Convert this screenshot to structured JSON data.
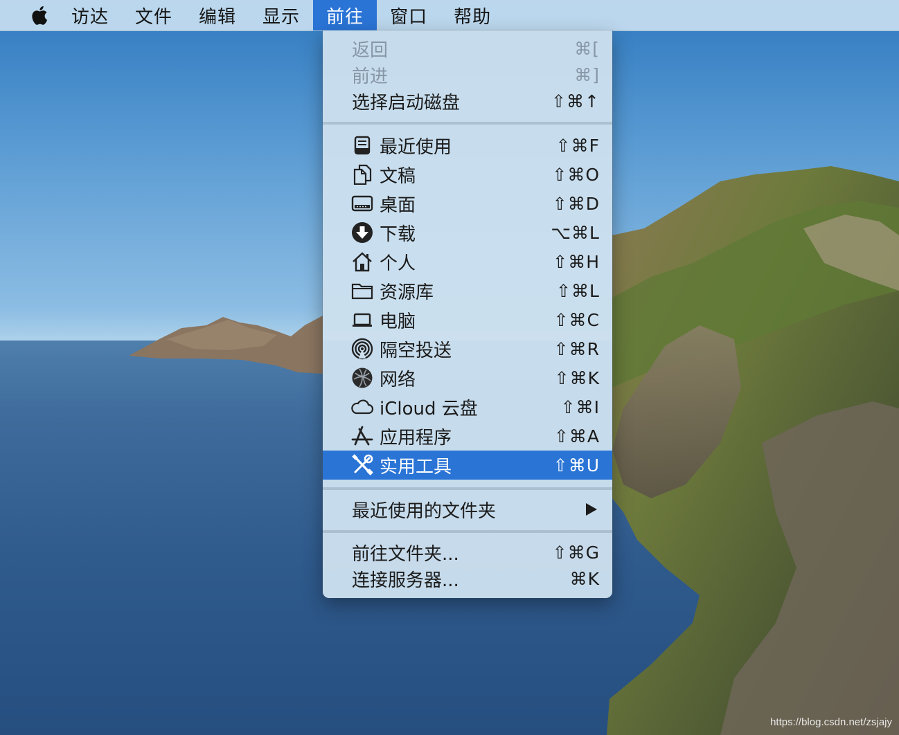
{
  "menubar": {
    "apple_icon": "apple-logo-icon",
    "items": [
      {
        "label": "访达"
      },
      {
        "label": "文件"
      },
      {
        "label": "编辑"
      },
      {
        "label": "显示"
      },
      {
        "label": "前往",
        "active": true
      },
      {
        "label": "窗口"
      },
      {
        "label": "帮助"
      }
    ]
  },
  "go_menu": {
    "nav": [
      {
        "label": "返回",
        "shortcut": "⌘[",
        "enabled": false
      },
      {
        "label": "前进",
        "shortcut": "⌘]",
        "enabled": false
      },
      {
        "label": "选择启动磁盘",
        "shortcut": "⇧⌘↑",
        "enabled": true
      }
    ],
    "places": [
      {
        "label": "最近使用",
        "shortcut": "⇧⌘F",
        "icon": "recents-icon"
      },
      {
        "label": "文稿",
        "shortcut": "⇧⌘O",
        "icon": "documents-icon"
      },
      {
        "label": "桌面",
        "shortcut": "⇧⌘D",
        "icon": "desktop-icon"
      },
      {
        "label": "下载",
        "shortcut": "⌥⌘L",
        "icon": "downloads-icon"
      },
      {
        "label": "个人",
        "shortcut": "⇧⌘H",
        "icon": "home-icon"
      },
      {
        "label": "资源库",
        "shortcut": "⇧⌘L",
        "icon": "folder-icon"
      },
      {
        "label": "电脑",
        "shortcut": "⇧⌘C",
        "icon": "computer-icon"
      },
      {
        "label": "隔空投送",
        "shortcut": "⇧⌘R",
        "icon": "airdrop-icon"
      },
      {
        "label": "网络",
        "shortcut": "⇧⌘K",
        "icon": "network-icon"
      },
      {
        "label": "iCloud 云盘",
        "shortcut": "⇧⌘I",
        "icon": "icloud-icon"
      },
      {
        "label": "应用程序",
        "shortcut": "⇧⌘A",
        "icon": "applications-icon"
      },
      {
        "label": "实用工具",
        "shortcut": "⇧⌘U",
        "icon": "utilities-icon",
        "selected": true
      }
    ],
    "recent_folders": {
      "label": "最近使用的文件夹",
      "icon": "submenu-arrow-icon"
    },
    "actions": [
      {
        "label": "前往文件夹...",
        "shortcut": "⇧⌘G"
      },
      {
        "label": "连接服务器...",
        "shortcut": "⌘K"
      }
    ]
  },
  "watermark": "https://blog.csdn.net/zsjajy",
  "colors": {
    "menubar_bg": "#c6def0",
    "menu_bg": "#cce0ee",
    "selection": "#2a74d6",
    "disabled_text": "#8796a6"
  }
}
